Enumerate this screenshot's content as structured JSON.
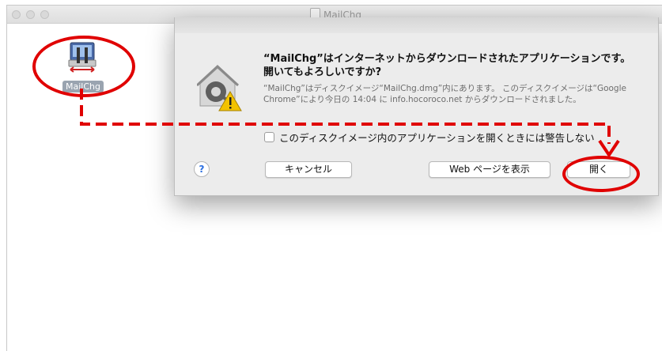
{
  "window": {
    "title": "MailChg"
  },
  "desktop_item": {
    "label": "MailChg",
    "icon": "app-tool-icon"
  },
  "dialog": {
    "title": "“MailChg”はインターネットからダウンロードされたアプリケーションです。開いてもよろしいですか?",
    "body": "“MailChg”はディスクイメージ“MailChg.dmg”内にあります。 このディスクイメージは“Google Chrome”により今日の 14:04 に info.hocoroco.net からダウンロードされました。",
    "checkbox_label": "このディスクイメージ内のアプリケーションを開くときには警告しない",
    "help_label": "?",
    "cancel_label": "キャンセル",
    "web_label": "Web ページを表示",
    "open_label": "開く"
  },
  "colors": {
    "annotation": "#e00000",
    "dialog_bg": "#ececec",
    "help_accent": "#2a6ee0"
  }
}
